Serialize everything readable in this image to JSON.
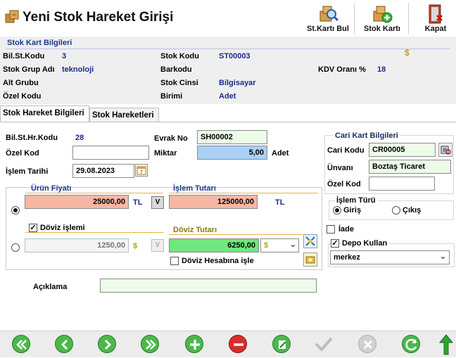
{
  "window": {
    "title": "Yeni Stok Hareket Girişi"
  },
  "toolbar": {
    "stkarti_bul": "St.Kartı Bul",
    "stok_karti": "Stok Kartı",
    "kapat": "Kapat"
  },
  "card": {
    "header": "Stok Kart Bilgileri",
    "bil_st_kodu_label": "Bil.St.Kodu",
    "bil_st_kodu": "3",
    "stok_kodu_label": "Stok Kodu",
    "stok_kodu": "ST00003",
    "currency_symbol": "$",
    "stok_grup_label": "Stok Grup Adı",
    "stok_grup": "teknoloji",
    "barkodu_label": "Barkodu",
    "kdv_label": "KDV Oranı %",
    "kdv": "18",
    "alt_grubu_label": "Alt Grubu",
    "stok_cinsi_label": "Stok Cinsi",
    "stok_cinsi": "Bilgisayar",
    "ozel_kodu_label": "Özel Kodu",
    "birimi_label": "Birimi",
    "birimi": "Adet"
  },
  "tabs": [
    {
      "label": "Stok Hareket Bilgileri"
    },
    {
      "label": "Stok Hareketleri"
    }
  ],
  "form": {
    "bil_st_hr_kodu_label": "Bil.St.Hr.Kodu",
    "bil_st_hr_kodu": "28",
    "evrak_no_label": "Evrak No",
    "evrak_no": "SH00002",
    "ozel_kod_label": "Özel Kod",
    "ozel_kod": "",
    "miktar_label": "Miktar",
    "miktar": "5,00",
    "miktar_unit": "Adet",
    "islem_tarihi_label": "İşlem Tarihi",
    "islem_tarihi": "29.08.2023",
    "urun_fiyati_label": "Ürün Fiyatı",
    "urun_fiyati": "25000,00",
    "tl1": "TL",
    "v_btn": "V",
    "islem_tutari_label": "İşlem Tutarı",
    "islem_tutari": "125000,00",
    "tl2": "TL",
    "doviz_islemi_label": "Döviz işlemi",
    "doviz_fiyat": "1250,00",
    "doviz_symbol": "$",
    "v_btn2": "V",
    "doviz_tutari_label": "Döviz Tutarı",
    "doviz_tutari": "6250,00",
    "doviz_select": "$",
    "doviz_hesabina_label": "Döviz Hesabına işle",
    "aciklama_label": "Açıklama",
    "aciklama": ""
  },
  "cari": {
    "header": "Cari Kart Bilgileri",
    "cari_kodu_label": "Cari Kodu",
    "cari_kodu": "CR00005",
    "unvani_label": "Ünvanı",
    "unvani": "Boztaş Ticaret",
    "ozel_kod_label": "Özel Kod",
    "ozel_kod": ""
  },
  "islem_turu": {
    "header": "İşlem Türü",
    "giris": "Giriş",
    "cikis": "Çıkış",
    "selected": "Giriş"
  },
  "iade": {
    "label": "İade",
    "checked": false
  },
  "depo": {
    "label": "Depo Kullan",
    "checked": true,
    "selected": "merkez"
  }
}
